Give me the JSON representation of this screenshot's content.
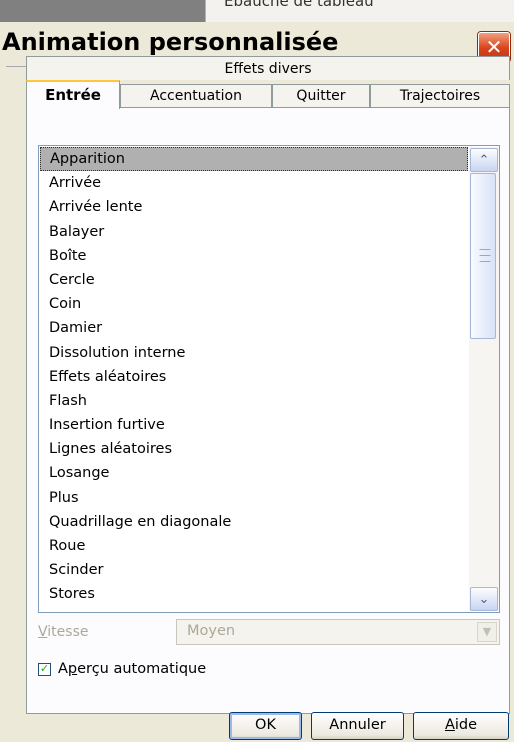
{
  "background": {
    "doc_text": "Ébauche de tableau"
  },
  "dialog": {
    "title": "Animation personnalisée",
    "close_symbol": "✕"
  },
  "tabs": {
    "top_row": [
      "Effets divers"
    ],
    "bottom_row": [
      "Entrée",
      "Accentuation",
      "Quitter",
      "Trajectoires"
    ],
    "active": "Entrée"
  },
  "effects": {
    "selected": "Apparition",
    "items": [
      "Apparition",
      "Arrivée",
      "Arrivée lente",
      "Balayer",
      "Boîte",
      "Cercle",
      "Coin",
      "Damier",
      "Dissolution interne",
      "Effets aléatoires",
      "Flash",
      "Insertion furtive",
      "Lignes aléatoires",
      "Losange",
      "Plus",
      "Quadrillage en diagonale",
      "Roue",
      "Scinder",
      "Stores"
    ]
  },
  "speed": {
    "label": "Vitesse",
    "value": "Moyen",
    "enabled": false
  },
  "auto_preview": {
    "label": "Aperçu automatique",
    "checked": true
  },
  "buttons": {
    "ok": "OK",
    "cancel": "Annuler",
    "help": "Aide"
  },
  "colors": {
    "selection": "#b0b0b0",
    "active_tab_accent": "#ffc83c",
    "close_button": "#d8431a"
  }
}
